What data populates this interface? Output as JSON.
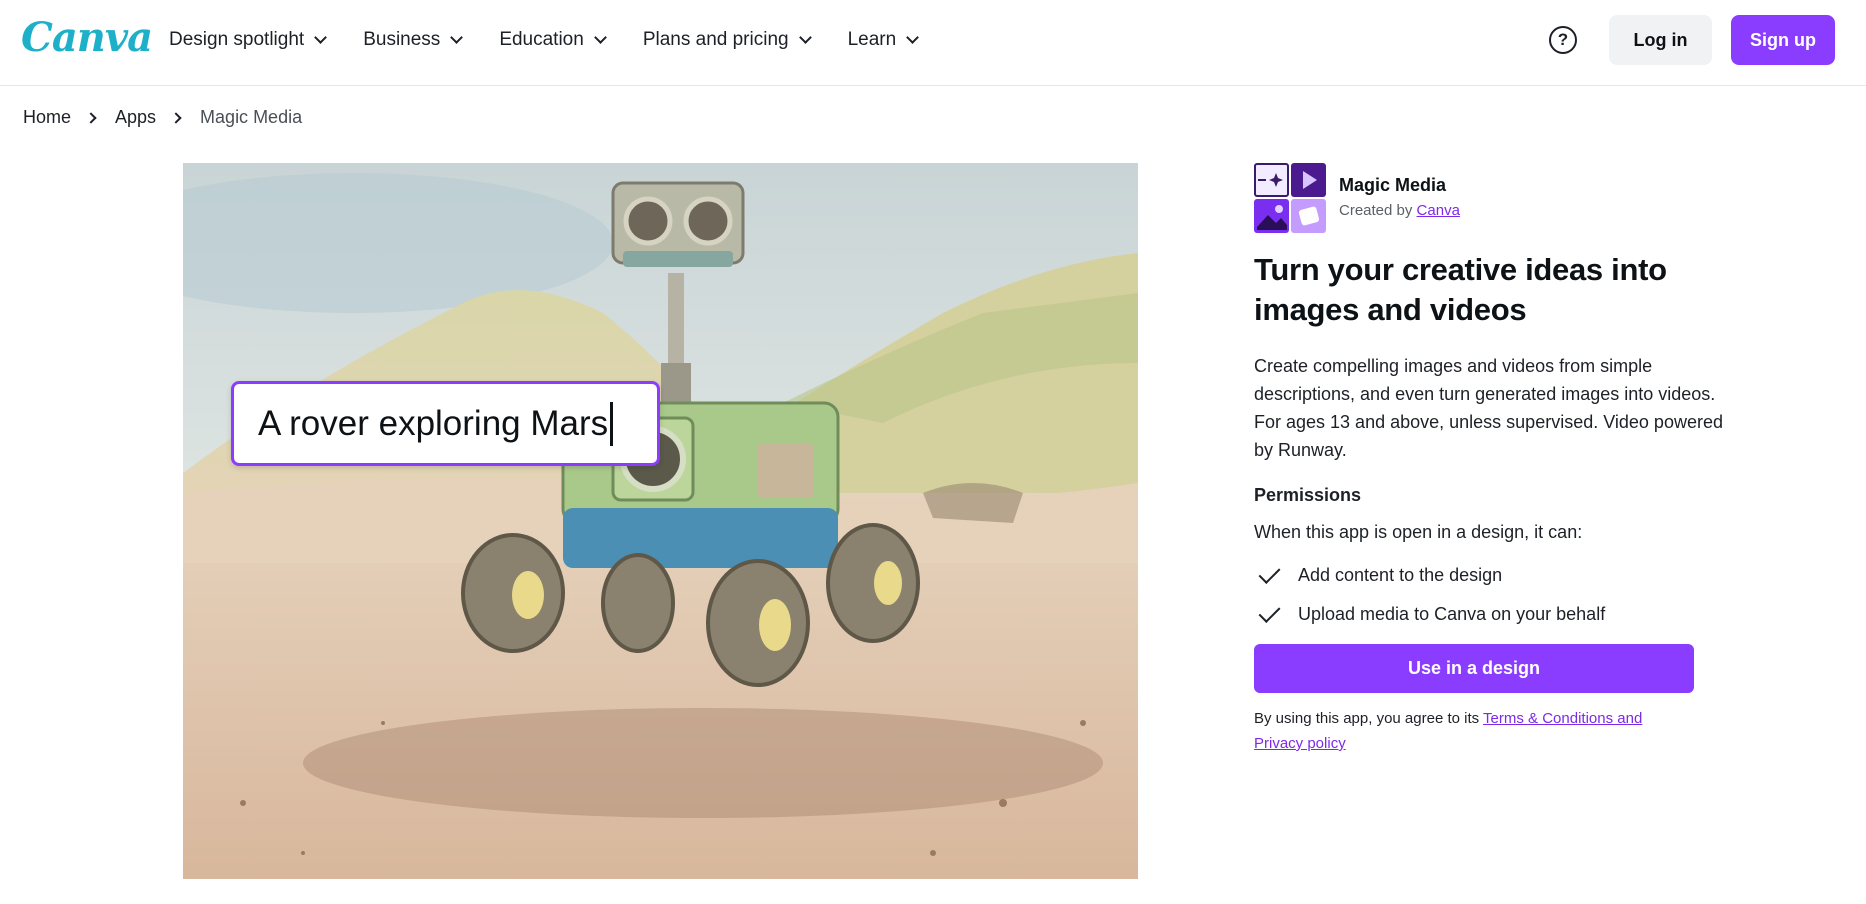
{
  "brand": {
    "logo_text": "Canva",
    "accent": "#8b3dff",
    "logo_color": "#1fb0c9"
  },
  "nav": {
    "items": [
      {
        "label": "Design spotlight"
      },
      {
        "label": "Business"
      },
      {
        "label": "Education"
      },
      {
        "label": "Plans and pricing"
      },
      {
        "label": "Learn"
      }
    ],
    "help_icon": "question-circle-icon",
    "help_symbol": "?",
    "login_label": "Log in",
    "signup_label": "Sign up"
  },
  "breadcrumb": {
    "items": [
      "Home",
      "Apps",
      "Magic Media"
    ]
  },
  "hero": {
    "prompt_text": "A rover exploring Mars"
  },
  "app": {
    "name": "Magic Media",
    "created_by_prefix": "Created by",
    "creator": "Canva",
    "headline": "Turn your creative ideas into images and videos",
    "description": "Create compelling images and videos from simple descriptions, and even turn generated images into videos. For ages 13 and above, unless supervised. Video powered by Runway.",
    "permissions_title": "Permissions",
    "permissions_intro": "When this app is open in a design, it can:",
    "permissions": [
      "Add content to the design",
      "Upload media to Canva on your behalf"
    ],
    "cta_label": "Use in a design",
    "terms_prefix": "By using this app, you agree to its",
    "terms_link": "Terms & Conditions and Privacy policy"
  }
}
